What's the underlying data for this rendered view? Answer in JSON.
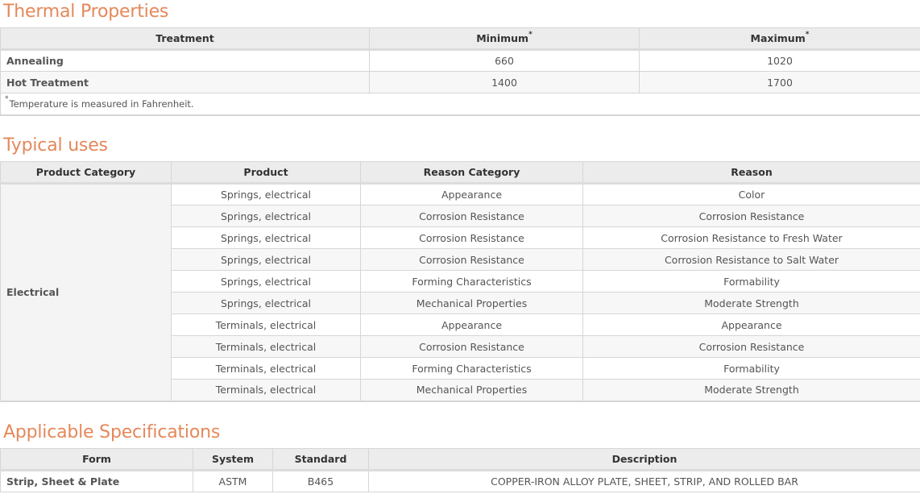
{
  "thermal": {
    "title": "Thermal Properties",
    "headers": {
      "treatment": "Treatment",
      "minimum": "Minimum",
      "maximum": "Maximum",
      "mark": "*"
    },
    "rows": [
      {
        "treatment": "Annealing",
        "min": "660",
        "max": "1020"
      },
      {
        "treatment": "Hot Treatment",
        "min": "1400",
        "max": "1700"
      }
    ],
    "note_mark": "*",
    "note": "Temperature is measured in Fahrenheit."
  },
  "uses": {
    "title": "Typical uses",
    "headers": {
      "product_category": "Product Category",
      "product": "Product",
      "reason_category": "Reason Category",
      "reason": "Reason"
    },
    "group": "Electrical",
    "rows": [
      {
        "product": "Springs, electrical",
        "reason_category": "Appearance",
        "reason": "Color"
      },
      {
        "product": "Springs, electrical",
        "reason_category": "Corrosion Resistance",
        "reason": "Corrosion Resistance"
      },
      {
        "product": "Springs, electrical",
        "reason_category": "Corrosion Resistance",
        "reason": "Corrosion Resistance to Fresh Water"
      },
      {
        "product": "Springs, electrical",
        "reason_category": "Corrosion Resistance",
        "reason": "Corrosion Resistance to Salt Water"
      },
      {
        "product": "Springs, electrical",
        "reason_category": "Forming Characteristics",
        "reason": "Formability"
      },
      {
        "product": "Springs, electrical",
        "reason_category": "Mechanical Properties",
        "reason": "Moderate Strength"
      },
      {
        "product": "Terminals, electrical",
        "reason_category": "Appearance",
        "reason": "Appearance"
      },
      {
        "product": "Terminals, electrical",
        "reason_category": "Corrosion Resistance",
        "reason": "Corrosion Resistance"
      },
      {
        "product": "Terminals, electrical",
        "reason_category": "Forming Characteristics",
        "reason": "Formability"
      },
      {
        "product": "Terminals, electrical",
        "reason_category": "Mechanical Properties",
        "reason": "Moderate Strength"
      }
    ]
  },
  "specs": {
    "title": "Applicable Specifications",
    "headers": {
      "form": "Form",
      "system": "System",
      "standard": "Standard",
      "description": "Description"
    },
    "rows": [
      {
        "form": "Strip, Sheet & Plate",
        "system": "ASTM",
        "standard": "B465",
        "description": "COPPER-IRON ALLOY PLATE, SHEET, STRIP, AND ROLLED BAR"
      }
    ]
  }
}
